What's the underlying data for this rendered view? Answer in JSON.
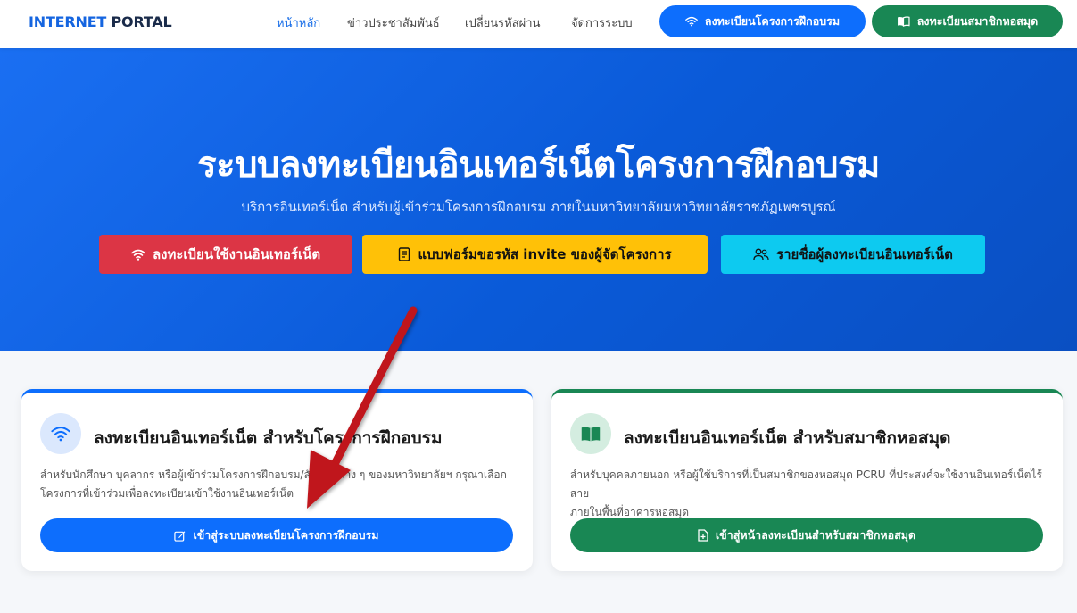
{
  "brand": {
    "part1": "INTERNET",
    "part2": "PORTAL"
  },
  "nav": {
    "links": [
      {
        "label": "หน้าหลัก",
        "active": true
      },
      {
        "label": "ข่าวประชาสัมพันธ์",
        "active": false
      },
      {
        "label": "เปลี่ยนรหัสผ่าน",
        "active": false
      },
      {
        "label": "จัดการระบบ",
        "active": false
      }
    ],
    "training_register_label": "ลงทะเบียนโครงการฝึกอบรม",
    "library_register_label": "ลงทะเบียนสมาชิกหอสมุด"
  },
  "hero": {
    "title": "ระบบลงทะเบียนอินเทอร์เน็ตโครงการฝึกอบรม",
    "subtitle": "บริการอินเทอร์เน็ต สำหรับผู้เข้าร่วมโครงการฝึกอบรม ภายในมหาวิทยาลัยมหาวิทยาลัยราชภัฏเพชรบูรณ์",
    "buttons": [
      {
        "label": "ลงทะเบียนใช้งานอินเทอร์เน็ต",
        "icon": "wifi-icon"
      },
      {
        "label": "แบบฟอร์มขอรหัส invite ของผู้จัดโครงการ",
        "icon": "form-icon"
      },
      {
        "label": "รายชื่อผู้ลงทะเบียนอินเทอร์เน็ต",
        "icon": "people-icon"
      }
    ]
  },
  "cards": {
    "training": {
      "title": "ลงทะเบียนอินเทอร์เน็ต สำหรับโครงการฝึกอบรม",
      "desc_line1": "สำหรับนักศึกษา บุคลากร หรือผู้เข้าร่วมโครงการฝึกอบรม/สัมมนาต่าง ๆ ของมหาวิทยาลัยฯ กรุณาเลือก",
      "desc_line2": "โครงการที่เข้าร่วมเพื่อลงทะเบียนเข้าใช้งานอินเทอร์เน็ต",
      "button_label": "เข้าสู่ระบบลงทะเบียนโครงการฝึกอบรม",
      "icon": "wifi-icon"
    },
    "library": {
      "title": "ลงทะเบียนอินเทอร์เน็ต สำหรับสมาชิกหอสมุด",
      "desc_line1": "สำหรับบุคคลภายนอก หรือผู้ใช้บริการที่เป็นสมาชิกของหอสมุด PCRU ที่ประสงค์จะใช้งานอินเทอร์เน็ตไร้สาย",
      "desc_line2": "ภายในพื้นที่อาคารหอสมุด",
      "button_label": "เข้าสู่หน้าลงทะเบียนสำหรับสมาชิกหอสมุด",
      "icon": "book-icon"
    }
  },
  "colors": {
    "primary": "#0d6efd",
    "success": "#198754",
    "danger": "#dc3545",
    "warning": "#ffc107",
    "info": "#0dcaf0",
    "annotation_arrow": "#c0141a"
  }
}
